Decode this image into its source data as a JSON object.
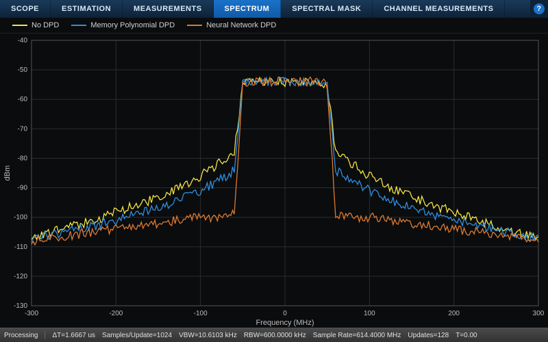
{
  "tabs": {
    "items": [
      {
        "label": "SCOPE",
        "active": false
      },
      {
        "label": "ESTIMATION",
        "active": false
      },
      {
        "label": "MEASUREMENTS",
        "active": false
      },
      {
        "label": "SPECTRUM",
        "active": true
      },
      {
        "label": "SPECTRAL MASK",
        "active": false
      },
      {
        "label": "CHANNEL MEASUREMENTS",
        "active": false
      }
    ],
    "help": "?"
  },
  "legend": {
    "items": [
      {
        "label": "No DPD",
        "color": "#f4e442"
      },
      {
        "label": "Memory Polynomial DPD",
        "color": "#2f8fe0"
      },
      {
        "label": "Neural Network DPD",
        "color": "#e07a2f"
      }
    ]
  },
  "status": {
    "state": "Processing",
    "fields": [
      "ΔT=1.6667 us",
      "Samples/Update=1024",
      "VBW=10.6103 kHz",
      "RBW=600.0000 kHz",
      "Sample Rate=614.4000 MHz",
      "Updates=128",
      "T=0.00"
    ]
  },
  "chart_data": {
    "type": "line",
    "title": "",
    "xlabel": "Frequency (MHz)",
    "ylabel": "dBm",
    "xlim": [
      -300,
      300
    ],
    "ylim": [
      -130,
      -40
    ],
    "xticks": [
      -300,
      -200,
      -100,
      0,
      100,
      200,
      300
    ],
    "yticks": [
      -130,
      -120,
      -110,
      -100,
      -90,
      -80,
      -70,
      -60,
      -50,
      -40
    ],
    "grid": true,
    "legend_position": "top",
    "x": [
      -300,
      -275,
      -250,
      -225,
      -200,
      -175,
      -150,
      -125,
      -100,
      -75,
      -60,
      -50,
      -40,
      -30,
      -20,
      -10,
      0,
      10,
      20,
      30,
      40,
      50,
      60,
      75,
      100,
      125,
      150,
      175,
      200,
      225,
      250,
      275,
      300
    ],
    "series": [
      {
        "name": "No DPD",
        "color": "#f4e442",
        "values": [
          -107,
          -105,
          -103,
          -101,
          -98,
          -96,
          -93,
          -90,
          -86,
          -81,
          -78,
          -55,
          -54,
          -54,
          -54,
          -54,
          -54,
          -54,
          -54,
          -54,
          -54,
          -55,
          -78,
          -81,
          -86,
          -90,
          -93,
          -96,
          -98,
          -101,
          -103,
          -105,
          -107
        ]
      },
      {
        "name": "Memory Polynomial DPD",
        "color": "#2f8fe0",
        "values": [
          -107,
          -106,
          -104,
          -103,
          -101,
          -99,
          -97,
          -94,
          -91,
          -87,
          -84,
          -55,
          -54,
          -54,
          -54,
          -54,
          -54,
          -54,
          -54,
          -54,
          -54,
          -55,
          -84,
          -87,
          -91,
          -94,
          -97,
          -99,
          -101,
          -103,
          -104,
          -106,
          -107
        ]
      },
      {
        "name": "Neural Network DPD",
        "color": "#e07a2f",
        "values": [
          -108,
          -107,
          -106,
          -105,
          -104,
          -103,
          -102,
          -101,
          -100,
          -100,
          -99,
          -55,
          -54,
          -54,
          -54,
          -54,
          -54,
          -54,
          -54,
          -54,
          -54,
          -55,
          -99,
          -100,
          -100,
          -101,
          -102,
          -103,
          -104,
          -105,
          -106,
          -107,
          -108
        ]
      }
    ],
    "noise_amplitude": 1.6
  }
}
